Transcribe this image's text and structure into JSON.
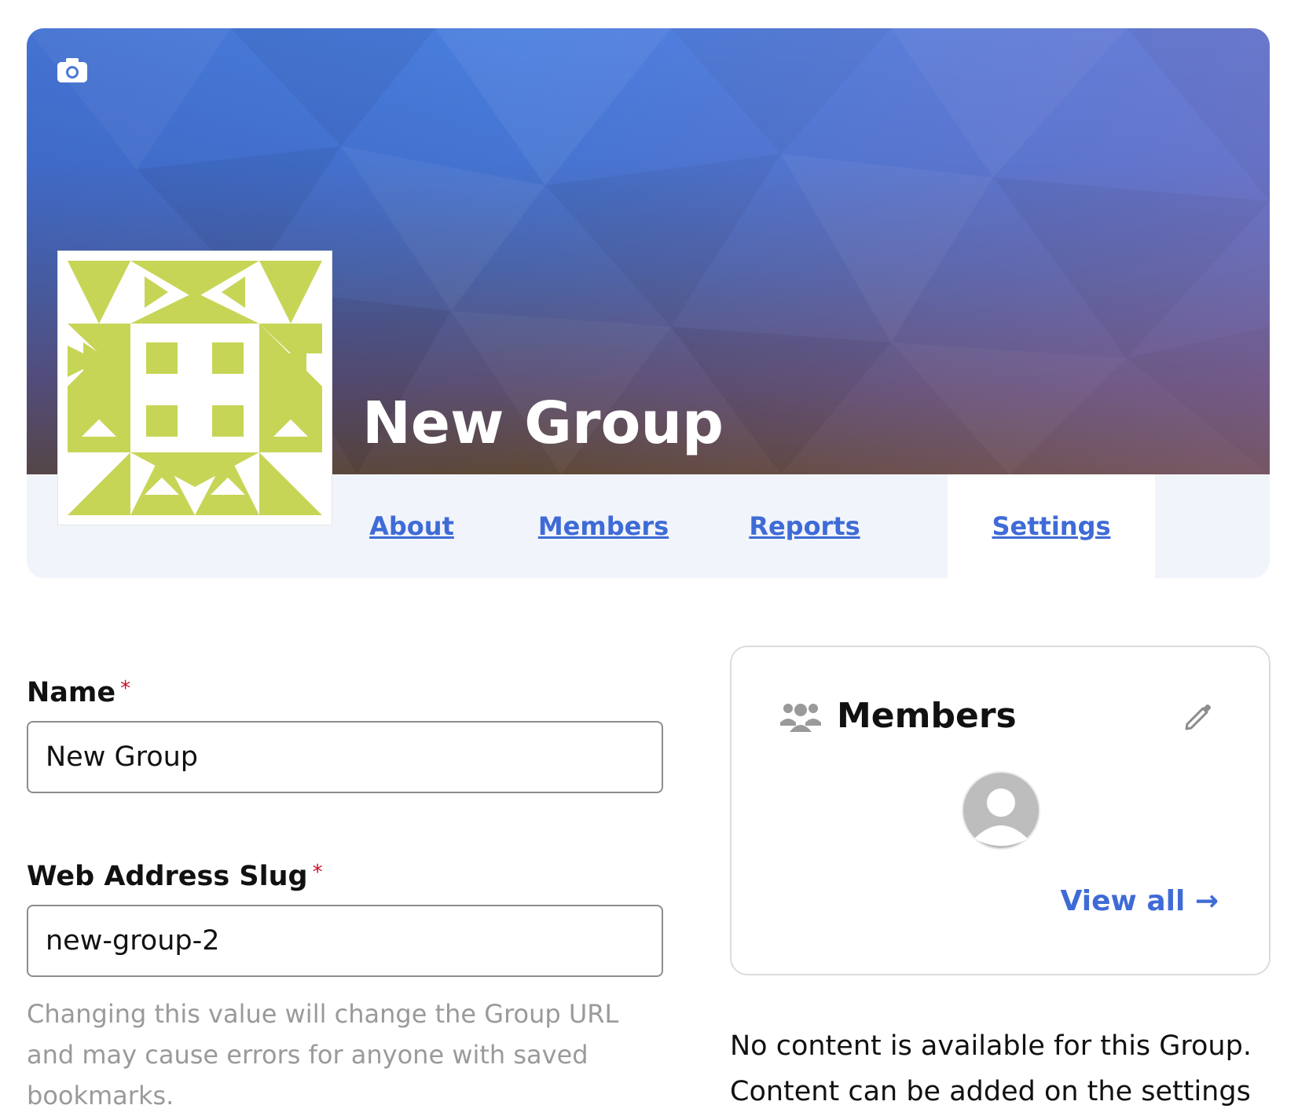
{
  "group": {
    "title": "New Group"
  },
  "tabs": [
    {
      "label": "About",
      "active": false
    },
    {
      "label": "Members",
      "active": false
    },
    {
      "label": "Reports",
      "active": false
    },
    {
      "label": "Settings",
      "active": true
    }
  ],
  "form": {
    "name_label": "Name",
    "name_required": "*",
    "name_value": "New Group",
    "slug_label": "Web Address Slug",
    "slug_required": "*",
    "slug_value": "new-group-2",
    "slug_help": "Changing this value will change the Group URL and may cause errors for anyone with saved bookmarks."
  },
  "members_card": {
    "title": "Members",
    "view_all": "View all →"
  },
  "empty_content": "No content is available for this Group. Content can be added on the settings",
  "colors": {
    "link": "#3f6bd6",
    "identicon": "#c7d557",
    "required": "#c8102e"
  },
  "icons": {
    "banner_upload": "camera-icon",
    "members_header": "users-icon",
    "edit": "pencil-icon",
    "member_avatar": "user-avatar-icon"
  }
}
